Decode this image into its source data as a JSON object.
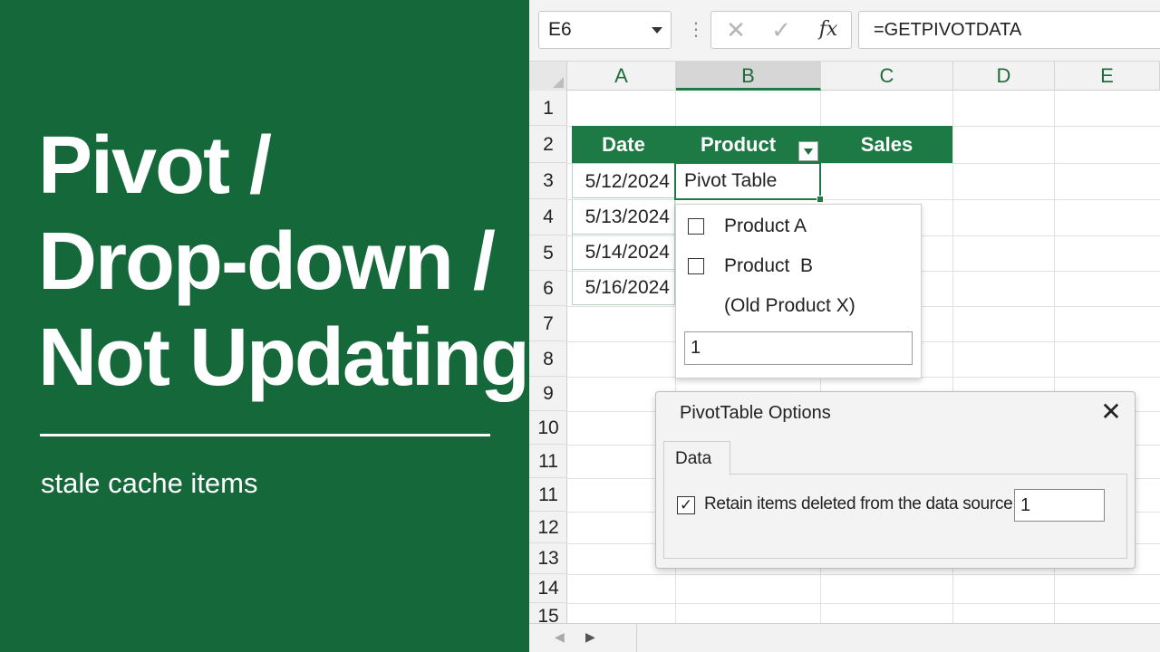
{
  "banner": {
    "title_lines": [
      "Pivot /",
      "Drop-down /",
      "Not Updating"
    ],
    "subtitle": "stale cache items"
  },
  "formula_bar": {
    "name_box": "E6",
    "cancel_icon": "✕",
    "enter_icon": "✓",
    "fx_label": "fx",
    "formula": "=GETPIVOTDATA"
  },
  "columns": [
    "A",
    "B",
    "C",
    "D",
    "E"
  ],
  "rows": [
    "1",
    "2",
    "3",
    "4",
    "5",
    "6",
    "7",
    "8",
    "9",
    "10",
    "11",
    "11",
    "12",
    "13",
    "14",
    "15"
  ],
  "table": {
    "headers": [
      "Date",
      "Product",
      "Sales"
    ],
    "dates": [
      "5/12/2024",
      "5/13/2024",
      "5/14/2024",
      "5/16/2024"
    ],
    "active_cell_value": "Pivot Table"
  },
  "filter_dropdown": {
    "items": [
      {
        "label": "Product A",
        "checked": false
      },
      {
        "label": "Product  B",
        "checked": false
      },
      {
        "label": "(Old Product X)"
      }
    ],
    "search_value": "1"
  },
  "pivot_options_dialog": {
    "title": "PivotTable Options",
    "close_icon": "✕",
    "tab": "Data",
    "checkbox_label": "Retain items deleted from the data source",
    "checkbox_mark": "✓",
    "value": "1"
  },
  "sheet_bar": {
    "prev_icon": "◀",
    "next_icon": "▶"
  },
  "colors": {
    "banner_green": "#14683a",
    "header_green": "#1e7a45"
  }
}
